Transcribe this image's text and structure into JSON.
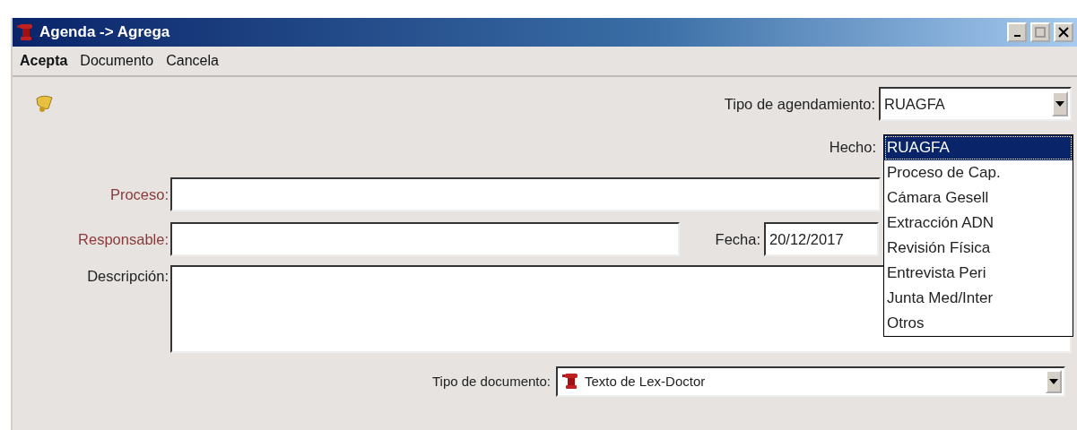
{
  "window": {
    "title": "Agenda -> Agrega"
  },
  "menu": [
    {
      "label": "Acepta",
      "default": true
    },
    {
      "label": "Documento",
      "default": false
    },
    {
      "label": "Cancela",
      "default": false
    }
  ],
  "tipo_agendamiento": {
    "label": "Tipo de agendamiento:",
    "value": "RUAGFA",
    "expanded": true,
    "options": [
      {
        "label": "RUAGFA",
        "selected": true
      },
      {
        "label": "Proceso de Cap.",
        "selected": false
      },
      {
        "label": "Cámara Gesell",
        "selected": false
      },
      {
        "label": "Extracción ADN",
        "selected": false
      },
      {
        "label": "Revisión Física",
        "selected": false
      },
      {
        "label": "Entrevista Peri",
        "selected": false
      },
      {
        "label": "Junta Med/Inter",
        "selected": false
      },
      {
        "label": "Otros",
        "selected": false
      }
    ]
  },
  "hecho": {
    "label": "Hecho:"
  },
  "proceso": {
    "label": "Proceso:",
    "color": "#8b3a3a"
  },
  "responsable": {
    "label": "Responsable:",
    "color": "#8b3a3a"
  },
  "fecha": {
    "label": "Fecha:",
    "value": "20/12/2017"
  },
  "descripcion": {
    "label": "Descripción:",
    "color": "#222222"
  },
  "tipo_documento": {
    "label": "Tipo de documento:",
    "value": "Texto de Lex-Doctor"
  }
}
